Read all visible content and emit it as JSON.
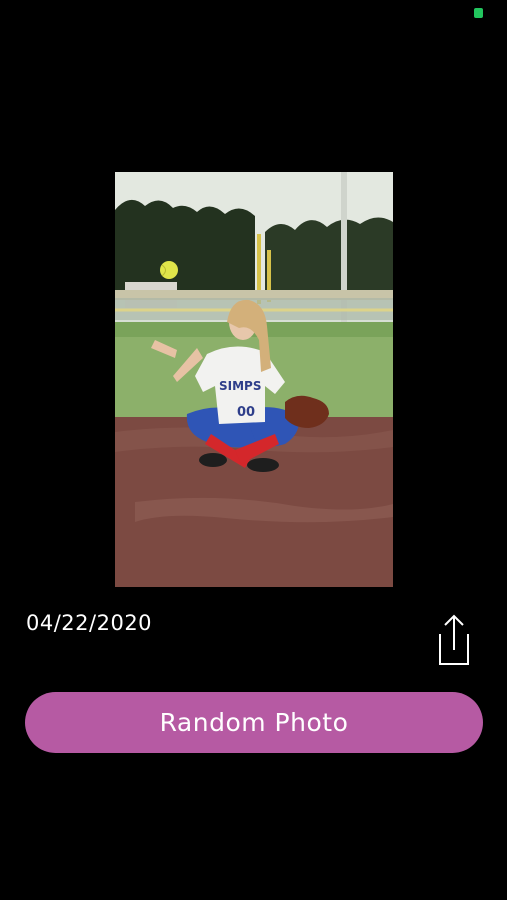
{
  "status_bar": {
    "indicator_color": "#22c55e"
  },
  "photo": {
    "subject": "softball-player-photo",
    "jersey_text": "SIMPSON",
    "jersey_number": "00"
  },
  "photo_date": "04/22/2020",
  "share": {
    "icon": "share-icon"
  },
  "random_button": {
    "label": "Random Photo",
    "color": "#b65aa3"
  }
}
